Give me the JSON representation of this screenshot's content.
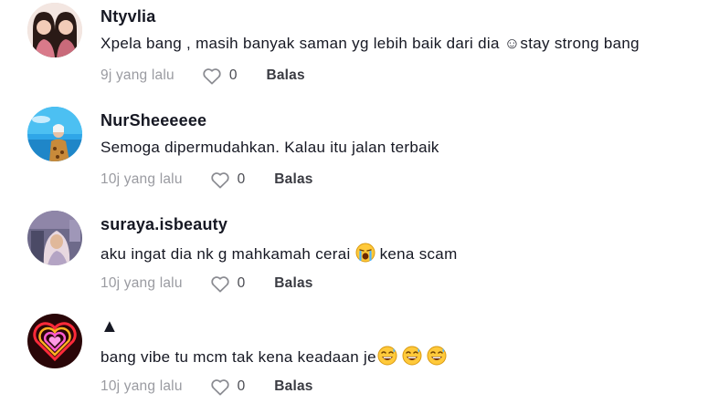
{
  "comments": [
    {
      "username": "Ntyvlia",
      "text": "Xpela bang , masih banyak saman yg lebih baik dari dia ☺stay strong bang",
      "time": "9j yang lalu",
      "likes": "0",
      "reply_label": "Balas",
      "avatar_icon": "avatar-photo-two-women"
    },
    {
      "username": "NurSheeeeee",
      "text": "Semoga dipermudahkan. Kalau itu jalan terbaik",
      "time": "10j yang lalu",
      "likes": "0",
      "reply_label": "Balas",
      "avatar_icon": "avatar-photo-beach"
    },
    {
      "username": "suraya.isbeauty",
      "text_before_emoji": "aku ingat dia nk g mahkamah cerai",
      "text_after_emoji": "kena scam",
      "emoji": "loudly-crying-face-emoji",
      "time": "10j yang lalu",
      "likes": "0",
      "reply_label": "Balas",
      "avatar_icon": "avatar-photo-hijab"
    },
    {
      "username": "▲",
      "text": "bang vibe tu mcm tak kena keadaan je",
      "emoji": "grinning-sweat-face-emoji",
      "emoji_count": 3,
      "time": "10j yang lalu",
      "likes": "0",
      "reply_label": "Balas",
      "avatar_icon": "avatar-neon-heart"
    }
  ],
  "colors": {
    "text": "#161823",
    "muted": "#9a9ba1",
    "like_icon": "#8a8b91"
  }
}
